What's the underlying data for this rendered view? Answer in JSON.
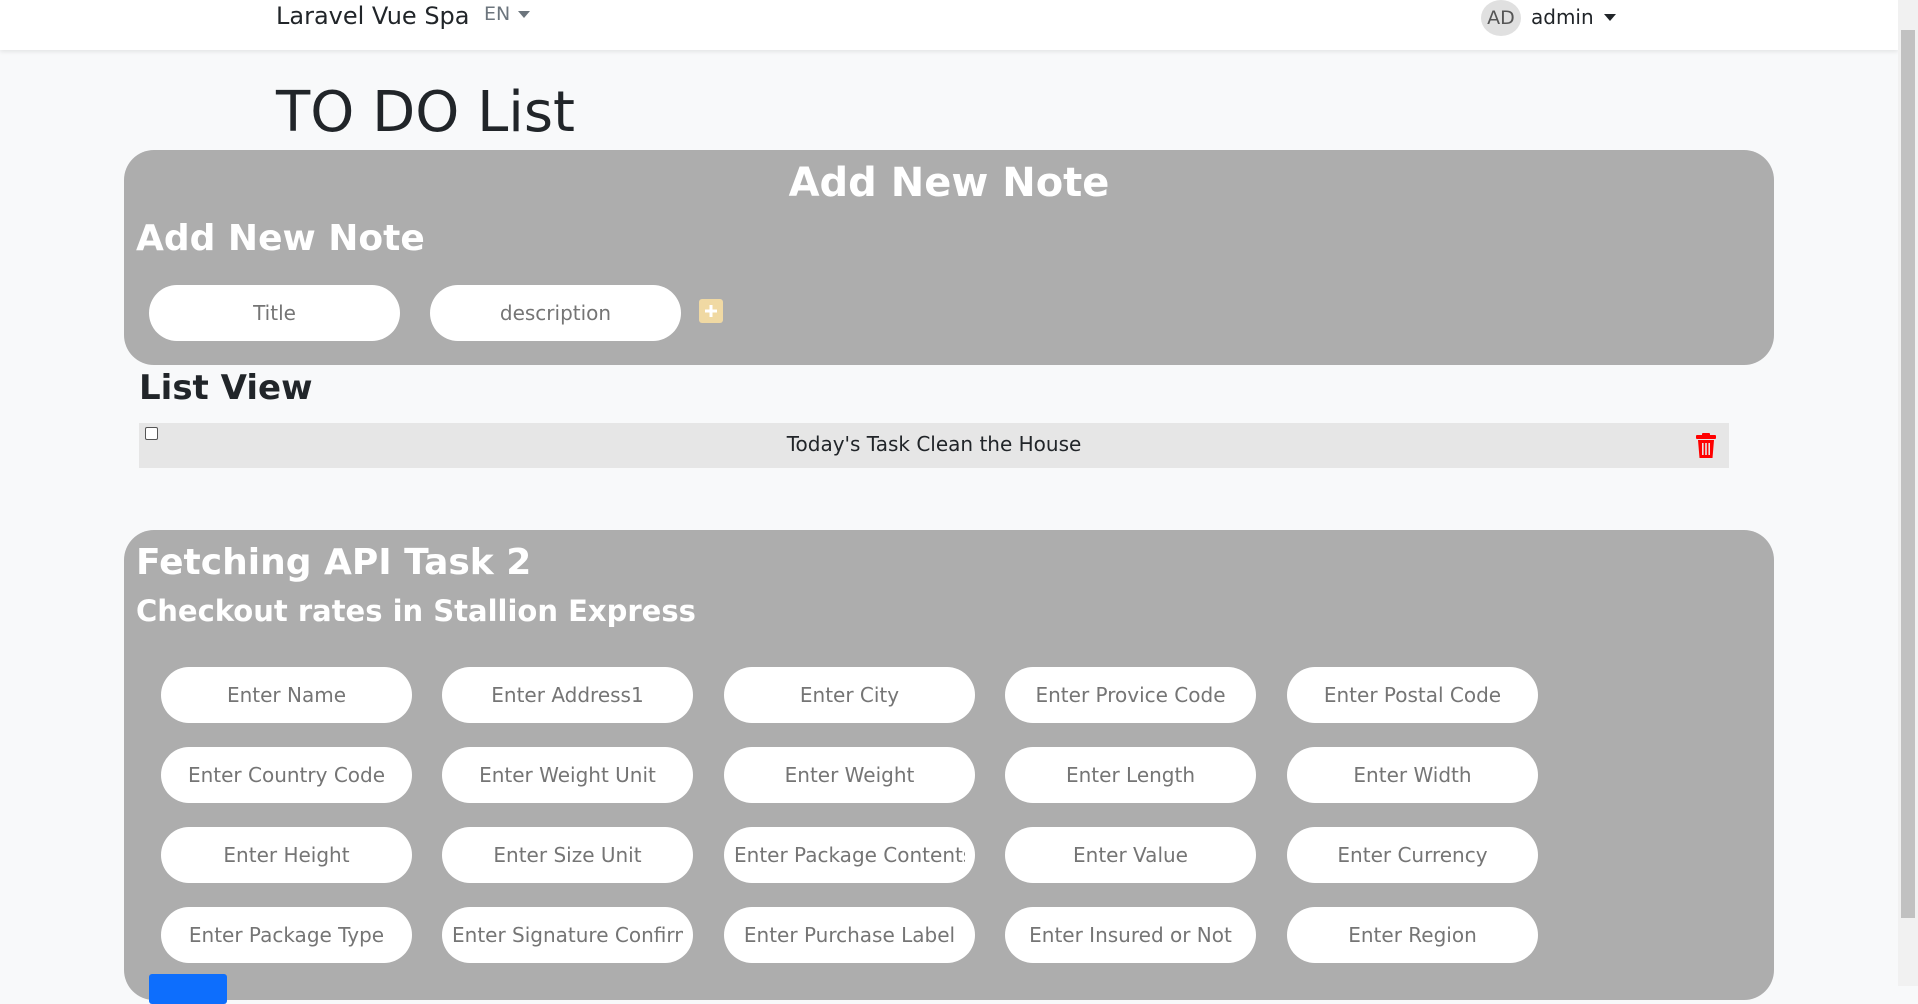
{
  "navbar": {
    "brand": "Laravel Vue Spa",
    "lang": "EN",
    "avatar_initials": "AD",
    "username": "admin"
  },
  "page": {
    "title": "TO DO List"
  },
  "add_note": {
    "heading": "Add New Note",
    "subheading": "Add New Note",
    "title_placeholder": "Title",
    "description_placeholder": "description",
    "add_icon": "plus-square-icon"
  },
  "list_view": {
    "heading": "List View",
    "items": [
      {
        "text": "Today's Task Clean the House",
        "checked": false
      }
    ],
    "delete_icon": "trash-icon"
  },
  "api_task": {
    "heading": "Fetching API Task 2",
    "subheading": "Checkout rates in Stallion Express",
    "fields": [
      "Enter Name",
      "Enter Address1",
      "Enter City",
      "Enter Provice Code",
      "Enter Postal Code",
      "Enter Country Code",
      "Enter Weight Unit",
      "Enter Weight",
      "Enter Length",
      "Enter Width",
      "Enter Height",
      "Enter Size Unit",
      "Enter Package Contents",
      "Enter Value",
      "Enter Currency",
      "Enter Package Type",
      "Enter Signature Confirmation",
      "Enter Purchase Label",
      "Enter Insured or Not",
      "Enter Region"
    ]
  },
  "colors": {
    "card_bg": "#adadad",
    "accent_blue": "#0d6efd",
    "delete_red": "#ff0000",
    "add_icon": "#f0d9a3"
  }
}
